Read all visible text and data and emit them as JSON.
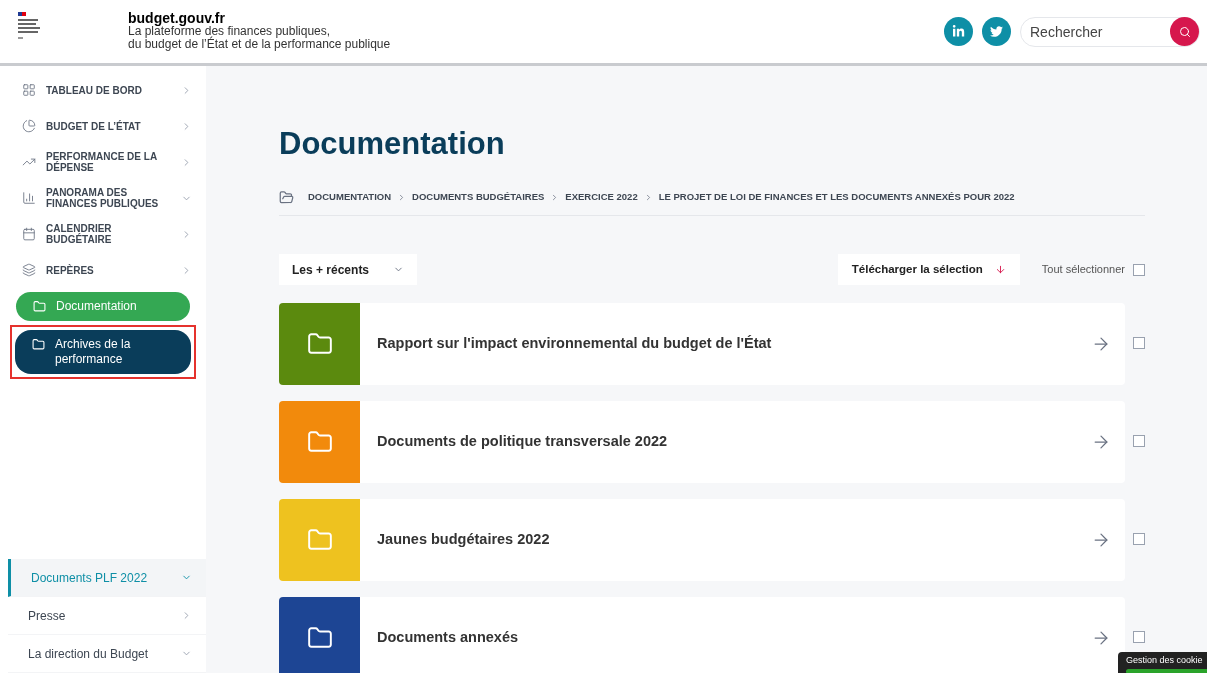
{
  "header": {
    "site_name": "budget.gouv.fr",
    "tagline_line1": "La plateforme des finances publiques,",
    "tagline_line2": "du budget de l’État et de la performance publique",
    "search": {
      "placeholder": "Rechercher"
    }
  },
  "sidebar": {
    "items": [
      {
        "kind": "grid",
        "label": "TABLEAU DE BORD",
        "expanded": false
      },
      {
        "kind": "pie",
        "label": "BUDGET DE L’ÉTAT",
        "expanded": false
      },
      {
        "kind": "trend",
        "label": "PERFORMANCE DE LA DÉPENSE",
        "expanded": false
      },
      {
        "kind": "bars",
        "label": "PANORAMA DES FINANCES PUBLIQUES",
        "expanded": true
      },
      {
        "kind": "calendar",
        "label": "CALENDRIER BUDGÉTAIRE",
        "expanded": false
      },
      {
        "kind": "layers",
        "label": "REPÈRES",
        "expanded": false
      }
    ],
    "pills": [
      {
        "label": "Documentation",
        "color": "#34a853",
        "highlighted": false
      },
      {
        "label": "Archives de la performance",
        "color": "#0a3d5a",
        "highlighted": true
      }
    ],
    "bottom_items": [
      {
        "label": "Documents PLF 2022",
        "selected": true,
        "expanded": true
      },
      {
        "label": "Presse",
        "selected": false,
        "expanded": false
      },
      {
        "label": "La direction du Budget",
        "selected": false,
        "expanded": true
      }
    ]
  },
  "main": {
    "title": "Documentation",
    "breadcrumb": [
      "DOCUMENTATION",
      "DOCUMENTS BUDGÉTAIRES",
      "EXERCICE 2022",
      "LE PROJET DE LOI DE FINANCES ET LES DOCUMENTS ANNEXÉS POUR 2022"
    ],
    "sort": "Les + récents",
    "download": "Télécharger la sélection",
    "select_all": {
      "label": "Tout sélectionner",
      "checked": false
    },
    "folders": [
      {
        "title": "Rapport sur l'impact environnemental du budget de l'État",
        "color": "#5b8a0e",
        "checked": false
      },
      {
        "title": "Documents de politique transversale 2022",
        "color": "#f28a0c",
        "checked": false
      },
      {
        "title": "Jaunes budgétaires 2022",
        "color": "#eec21f",
        "checked": false
      },
      {
        "title": "Documents annexés",
        "color": "#1d4594",
        "checked": false
      }
    ]
  },
  "cookie_banner": {
    "label": "Gestion des cookie"
  }
}
